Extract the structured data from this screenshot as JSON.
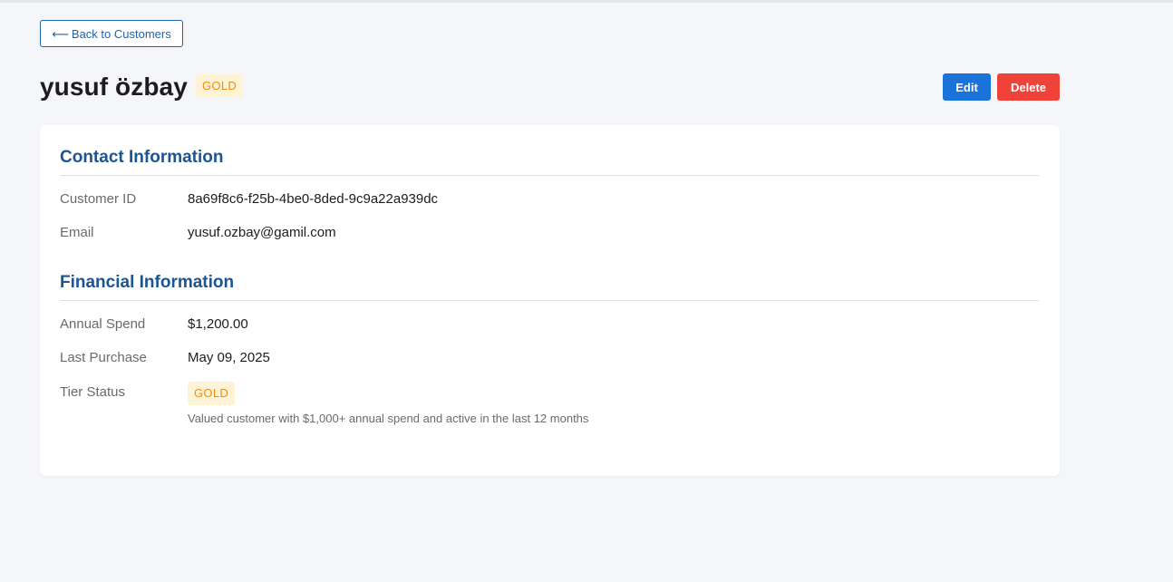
{
  "nav": {
    "back_arrow": "⟵",
    "back_label": "Back to Customers"
  },
  "customer": {
    "name": "yusuf özbay",
    "tier": "GOLD"
  },
  "actions": {
    "edit_label": "Edit",
    "delete_label": "Delete"
  },
  "contact": {
    "title": "Contact Information",
    "id_label": "Customer ID",
    "id_value": "8a69f8c6-f25b-4be0-8ded-9c9a22a939dc",
    "email_label": "Email",
    "email_value": "yusuf.ozbay@gamil.com"
  },
  "financial": {
    "title": "Financial Information",
    "spend_label": "Annual Spend",
    "spend_value": "$1,200.00",
    "purchase_label": "Last Purchase",
    "purchase_value": "May 09, 2025",
    "tier_label": "Tier Status",
    "tier_value": "GOLD",
    "tier_description": "Valued customer with $1,000+ annual spend and active in the last 12 months"
  },
  "colors": {
    "page_background": "#f5f6f9",
    "primary": "#1a73d9",
    "danger": "#ef4238",
    "section_title": "#1b5592",
    "gold_badge_bg": "#fff3d6",
    "gold_badge_text": "#ef8d0c"
  },
  "icons": {
    "back": "arrow-left-icon"
  }
}
